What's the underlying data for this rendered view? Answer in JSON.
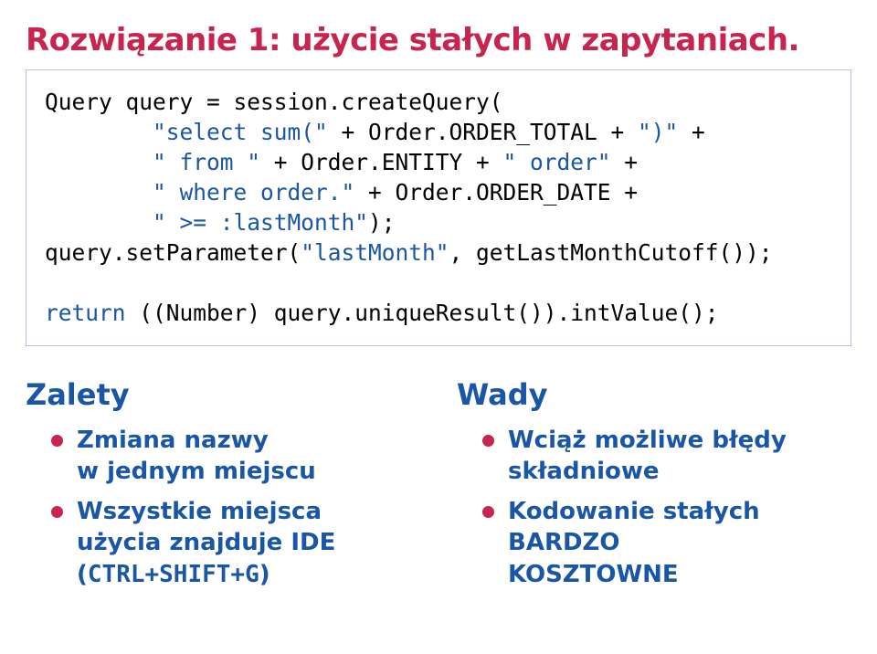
{
  "title": "Rozwiązanie 1: użycie stałych w zapytaniach.",
  "code": {
    "l1a": "Query query = session.createQuery(",
    "l2a": "        \"select sum(\"",
    "l2b": " + Order.ORDER_TOTAL + ",
    "l2c": "\")\"",
    "l2d": " + ",
    "l3a": "        \" from \"",
    "l3b": " + Order.ENTITY + ",
    "l3c": "\" order\"",
    "l3d": " + ",
    "l4a": "        \" where order.\"",
    "l4b": " + Order.ORDER_DATE + ",
    "l5a": "        \" >= :lastMonth\"",
    "l5b": ");",
    "l6a": "query.setParameter(",
    "l6b": "\"lastMonth\"",
    "l6c": ", getLastMonthCutoff());",
    "l7": "",
    "l8a": "return",
    "l8b": " ((Number) query.uniqueResult()).intValue();"
  },
  "left": {
    "heading": "Zalety",
    "items": [
      "Zmiana nazwy\nw jednym miejscu",
      "Wszystkie miejsca\nużycia znajduje IDE\n(CTRL+SHIFT+G)"
    ]
  },
  "right": {
    "heading": "Wady",
    "items": [
      "Wciąż możliwe błędy\nskładniowe",
      "Kodowanie stałych\nBARDZO\nKOSZTOWNE"
    ]
  }
}
